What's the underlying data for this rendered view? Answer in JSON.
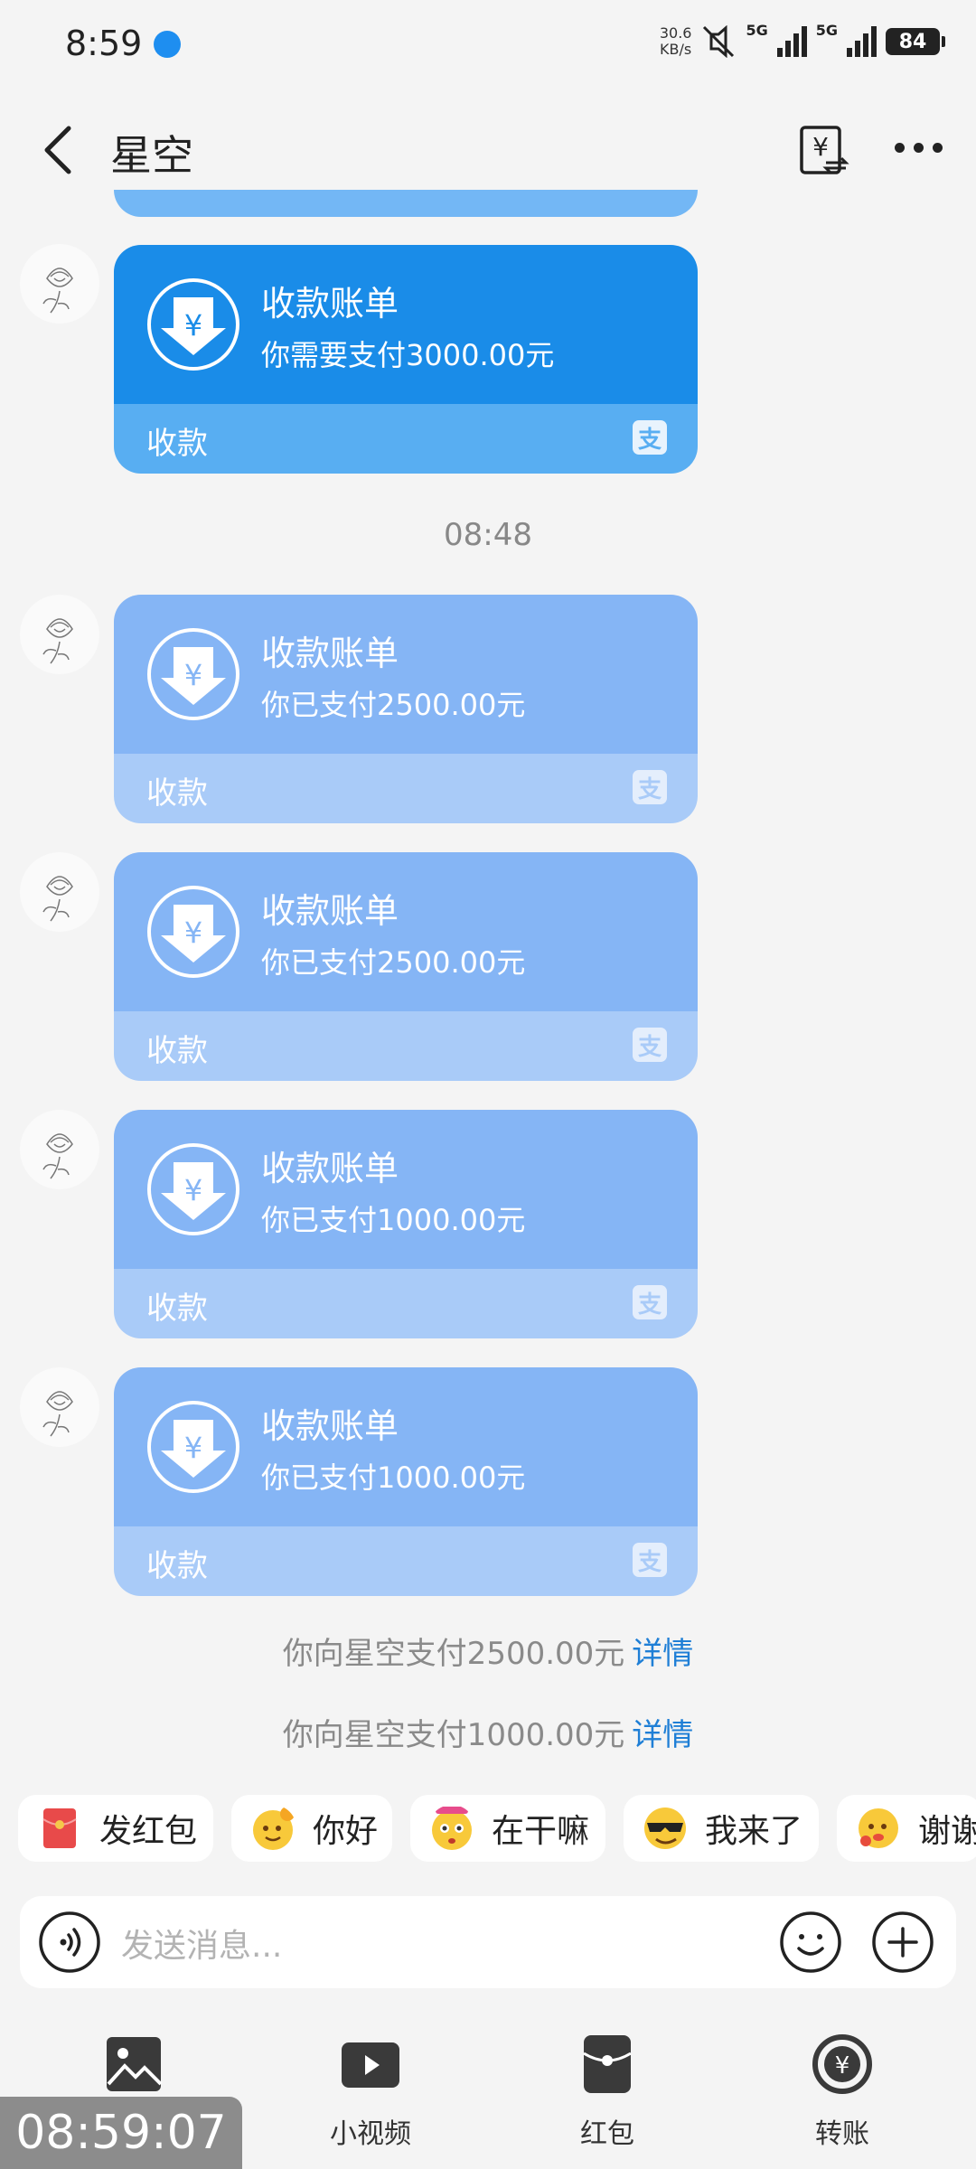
{
  "status_bar": {
    "time": "8:59",
    "net_speed_value": "30.6",
    "net_speed_unit": "KB/s",
    "net1": "5G",
    "net2": "5G",
    "battery": "84"
  },
  "header": {
    "title": "星空"
  },
  "messages": [
    {
      "title": "收款账单",
      "subtitle": "你需要支付3000.00元",
      "footer": "收款",
      "logo": "支",
      "state": "pending"
    },
    {
      "title": "收款账单",
      "subtitle": "你已支付2500.00元",
      "footer": "收款",
      "logo": "支",
      "state": "paid"
    },
    {
      "title": "收款账单",
      "subtitle": "你已支付2500.00元",
      "footer": "收款",
      "logo": "支",
      "state": "paid"
    },
    {
      "title": "收款账单",
      "subtitle": "你已支付1000.00元",
      "footer": "收款",
      "logo": "支",
      "state": "paid"
    },
    {
      "title": "收款账单",
      "subtitle": "你已支付1000.00元",
      "footer": "收款",
      "logo": "支",
      "state": "paid"
    }
  ],
  "timestamp": "08:48",
  "system_notices": [
    {
      "text": "你向星空支付2500.00元",
      "link": "详情"
    },
    {
      "text": "你向星空支付1000.00元",
      "link": "详情"
    }
  ],
  "quick_replies": [
    {
      "label": "发红包",
      "icon": "red-envelope-icon"
    },
    {
      "label": "你好",
      "icon": "hi-emoji-icon"
    },
    {
      "label": "在干嘛",
      "icon": "what-doing-emoji-icon"
    },
    {
      "label": "我来了",
      "icon": "sunglasses-emoji-icon"
    },
    {
      "label": "谢谢",
      "icon": "thanks-emoji-icon"
    }
  ],
  "input": {
    "placeholder": "发送消息..."
  },
  "toolbar": [
    {
      "label": "相册",
      "icon": "photo-icon"
    },
    {
      "label": "小视频",
      "icon": "video-icon"
    },
    {
      "label": "红包",
      "icon": "red-packet-icon"
    },
    {
      "label": "转账",
      "icon": "transfer-icon"
    }
  ],
  "overlay_timer": "08:59:07",
  "colors": {
    "card_pending": "#1a8ce8",
    "card_paid": "#85b5f5",
    "link": "#1f7fd6"
  }
}
